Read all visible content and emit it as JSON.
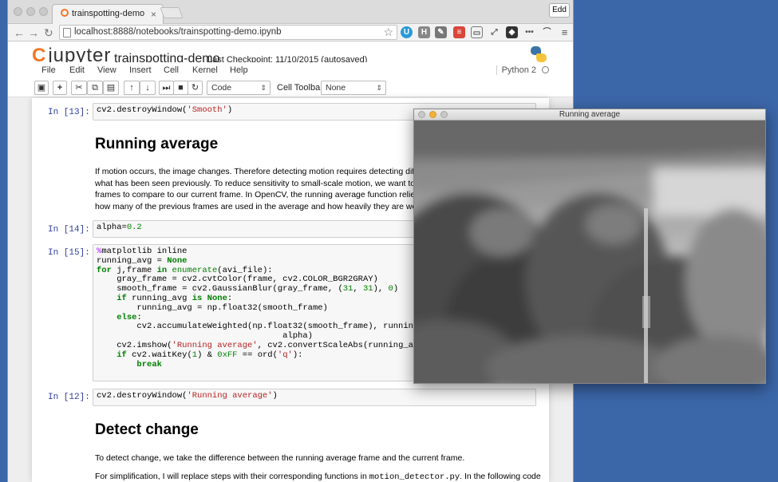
{
  "browser": {
    "tab_title": "trainspotting-demo",
    "tab_close": "×",
    "profile_button": "Edd",
    "url": "localhost:8888/notebooks/trainspotting-demo.ipynb"
  },
  "jupyter": {
    "logo_text": "jupyter",
    "notebook_title": "trainspotting-demo",
    "checkpoint": "Last Checkpoint: 11/10/2015 (autosaved)",
    "kernel_name": "Python 2",
    "menu": [
      "File",
      "Edit",
      "View",
      "Insert",
      "Cell",
      "Kernel",
      "Help"
    ],
    "cell_type": "Code",
    "cell_toolbar_label": "Cell Toolbar:",
    "cell_toolbar_value": "None"
  },
  "cells": {
    "c13_prompt": "In [13]:",
    "c14_prompt": "In [14]:",
    "c15_prompt": "In [15]:",
    "c12_prompt": "In [12]:",
    "h_running": "Running average",
    "p_running": [
      "If motion occurs, the image changes. Therefore detecting motion requires detecting differenc",
      "what has been seen previously. To reduce sensitivity to small-scale motion, we want to use a",
      "frames to compare to our current frame. In OpenCV, the running average function relies on a",
      "how many of the previous frames are used in the average and how heavily they are weighted."
    ],
    "h_detect": "Detect change",
    "p_detect_1": "To detect change, we take the difference between the running average frame and the current frame.",
    "p_detect_2a": "For simplification, I will replace steps with their corresponding functions in ",
    "p_detect_2b": "motion_detector.py",
    "p_detect_2c": ". In the following code"
  },
  "cv_window": {
    "title": "Running average"
  },
  "colors": {
    "desktop": "#3b66a8",
    "jupyter_orange": "#f37626",
    "prompt_blue": "#303f9f"
  }
}
